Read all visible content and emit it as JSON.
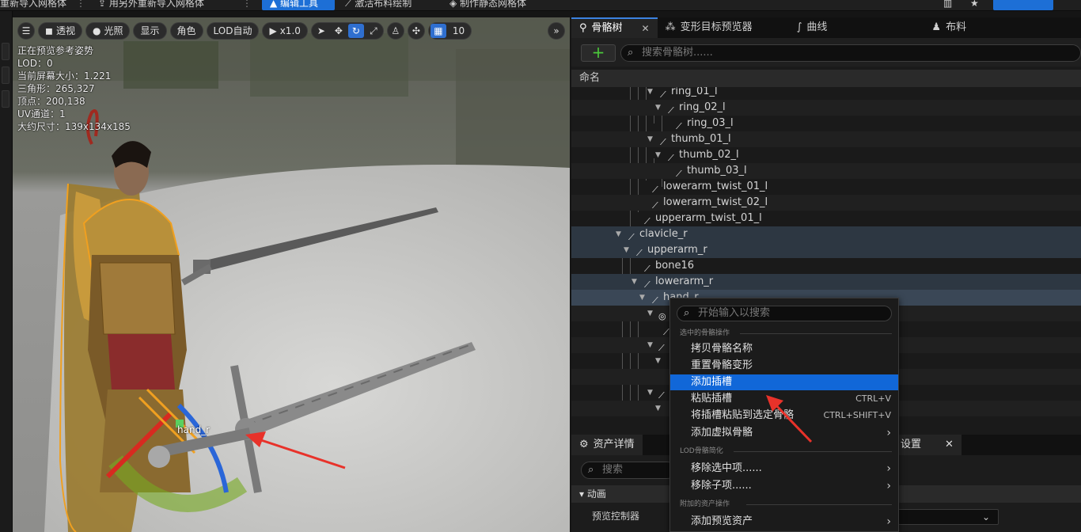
{
  "topbar": {
    "item1": "重新导入网格体",
    "item2": "用另外重新导入网格体",
    "edit_tool": "编辑工具",
    "item3": "激活布料绘制",
    "item4": "制作静态网格体"
  },
  "viewport": {
    "toolbar": {
      "perspective": "透视",
      "lighting": "光照",
      "show": "显示",
      "character": "角色",
      "lod": "LOD自动",
      "speed": "x1.0",
      "grid_value": "10"
    },
    "stats": [
      "正在预览参考姿势",
      "LOD：0",
      "当前屏幕大小：1.221",
      "三角形：265,327",
      "顶点：200,138",
      "UV通道：1",
      "大约尺寸：139x134x185"
    ],
    "bone_label": "hand_r"
  },
  "right_panel": {
    "tabs": [
      {
        "label": "骨骼树"
      },
      {
        "label": "变形目标预览器"
      },
      {
        "label": "曲线"
      },
      {
        "label": "布料"
      }
    ],
    "search_placeholder": "搜索骨骼树......",
    "column_header": "命名",
    "tree_rows": [
      {
        "label": "ring_01_l"
      },
      {
        "label": "ring_02_l"
      },
      {
        "label": "ring_03_l"
      },
      {
        "label": "thumb_01_l"
      },
      {
        "label": "thumb_02_l"
      },
      {
        "label": "thumb_03_l"
      },
      {
        "label": "lowerarm_twist_01_l"
      },
      {
        "label": "lowerarm_twist_02_l"
      },
      {
        "label": "upperarm_twist_01_l"
      },
      {
        "label": "clavicle_r"
      },
      {
        "label": "upperarm_r"
      },
      {
        "label": "bone16"
      },
      {
        "label": "lowerarm_r"
      },
      {
        "label": "hand_r"
      }
    ]
  },
  "lower_panel": {
    "tab_details": "资产详情",
    "tab_settings": "设置",
    "search_placeholder": "搜索",
    "section": "动画",
    "property": "预览控制器"
  },
  "context_menu": {
    "search_placeholder": "开始输入以搜索",
    "section1": "选中的骨骼操作",
    "items1": [
      {
        "label": "拷贝骨骼名称",
        "shortcut": ""
      },
      {
        "label": "重置骨骼变形",
        "shortcut": ""
      },
      {
        "label": "添加插槽",
        "shortcut": ""
      },
      {
        "label": "粘贴插槽",
        "shortcut": "CTRL+V"
      },
      {
        "label": "将插槽粘贴到选定骨骼",
        "shortcut": "CTRL+SHIFT+V"
      },
      {
        "label": "添加虚拟骨骼",
        "shortcut": ""
      }
    ],
    "section2": "LOD骨骼简化",
    "items2": [
      {
        "label": "移除选中项......"
      },
      {
        "label": "移除子项......"
      }
    ],
    "section3": "附加的资产操作",
    "items3": [
      {
        "label": "添加预览资产"
      }
    ]
  },
  "colors": {
    "accent_blue": "#1167d8",
    "highlight_row": "#3a4756",
    "arrow_red": "#e8322a"
  }
}
